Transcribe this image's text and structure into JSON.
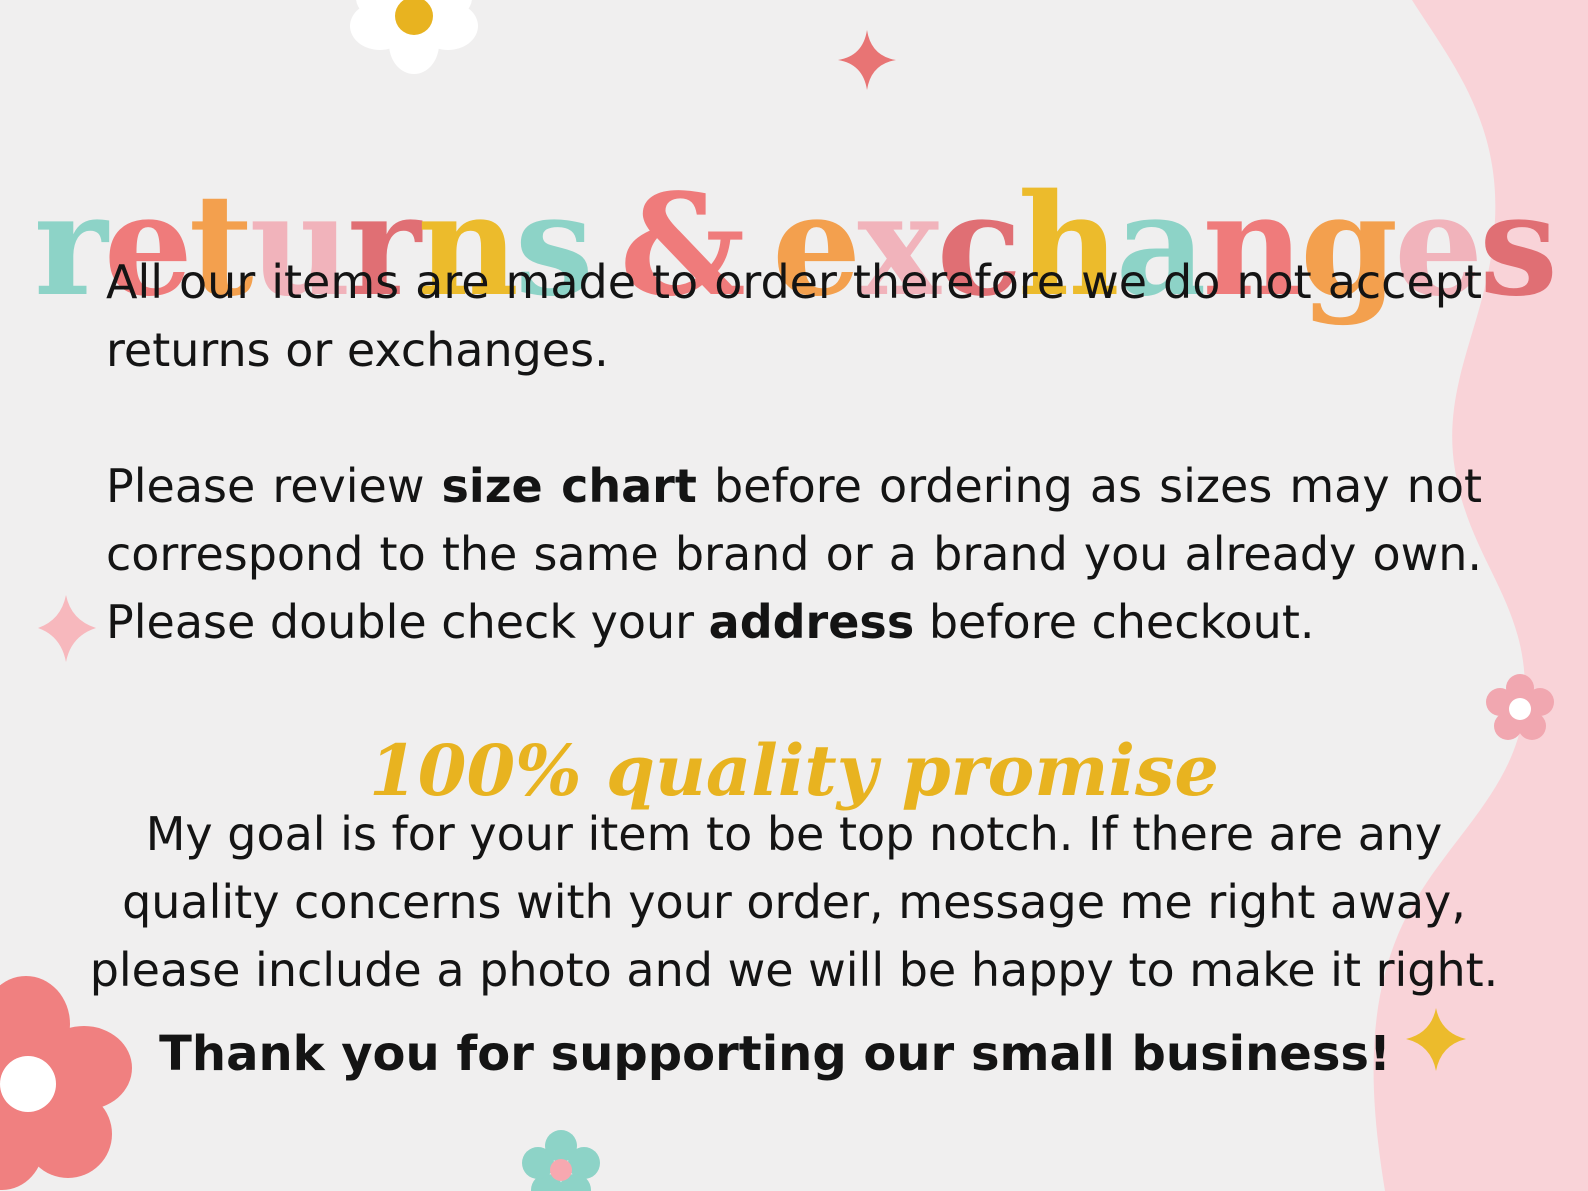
{
  "title": {
    "letters": [
      {
        "char": "r",
        "color": "#8dd3c7"
      },
      {
        "char": "e",
        "color": "#ef7b7b"
      },
      {
        "char": "t",
        "color": "#f3a04e"
      },
      {
        "char": "u",
        "color": "#f1b3bb"
      },
      {
        "char": "r",
        "color": "#e06f74"
      },
      {
        "char": "n",
        "color": "#ecbb2c"
      },
      {
        "char": "s",
        "color": "#8dd3c7"
      },
      {
        "char": " ",
        "color": "#000000"
      },
      {
        "char": "&",
        "color": "#ef7b7b"
      },
      {
        "char": " ",
        "color": "#000000"
      },
      {
        "char": "e",
        "color": "#f3a04e"
      },
      {
        "char": "x",
        "color": "#f1b3bb"
      },
      {
        "char": "c",
        "color": "#e06f74"
      },
      {
        "char": "h",
        "color": "#ecbb2c"
      },
      {
        "char": "a",
        "color": "#8dd3c7"
      },
      {
        "char": "n",
        "color": "#ef7b7b"
      },
      {
        "char": "g",
        "color": "#f3a04e"
      },
      {
        "char": "e",
        "color": "#f1b3bb"
      },
      {
        "char": "s",
        "color": "#e06f74"
      }
    ]
  },
  "paragraph1": "All our items are made to order therefore we do not accept returns or exchanges.",
  "paragraph2": {
    "part1": "Please review ",
    "bold1": "size chart",
    "part2": " before ordering as sizes may not correspond to the same brand or a brand you already own. Please double check your ",
    "bold2": "address",
    "part3": " before checkout."
  },
  "subtitle": "100% quality promise",
  "paragraph3": {
    "line1": "My goal is for your item to be top notch. If there are any",
    "line2": "quality concerns with your order, message me right away,",
    "line3": "please include a photo and we will be happy to make it right."
  },
  "thanks": "Thank you for supporting our small business!",
  "colors": {
    "background": "#f0efef",
    "pink_wave": "#f9d3d8",
    "coral": "#f08080",
    "mint": "#8dd3c7",
    "yellow": "#e8b320",
    "pink_flower": "#f1a7b0"
  }
}
